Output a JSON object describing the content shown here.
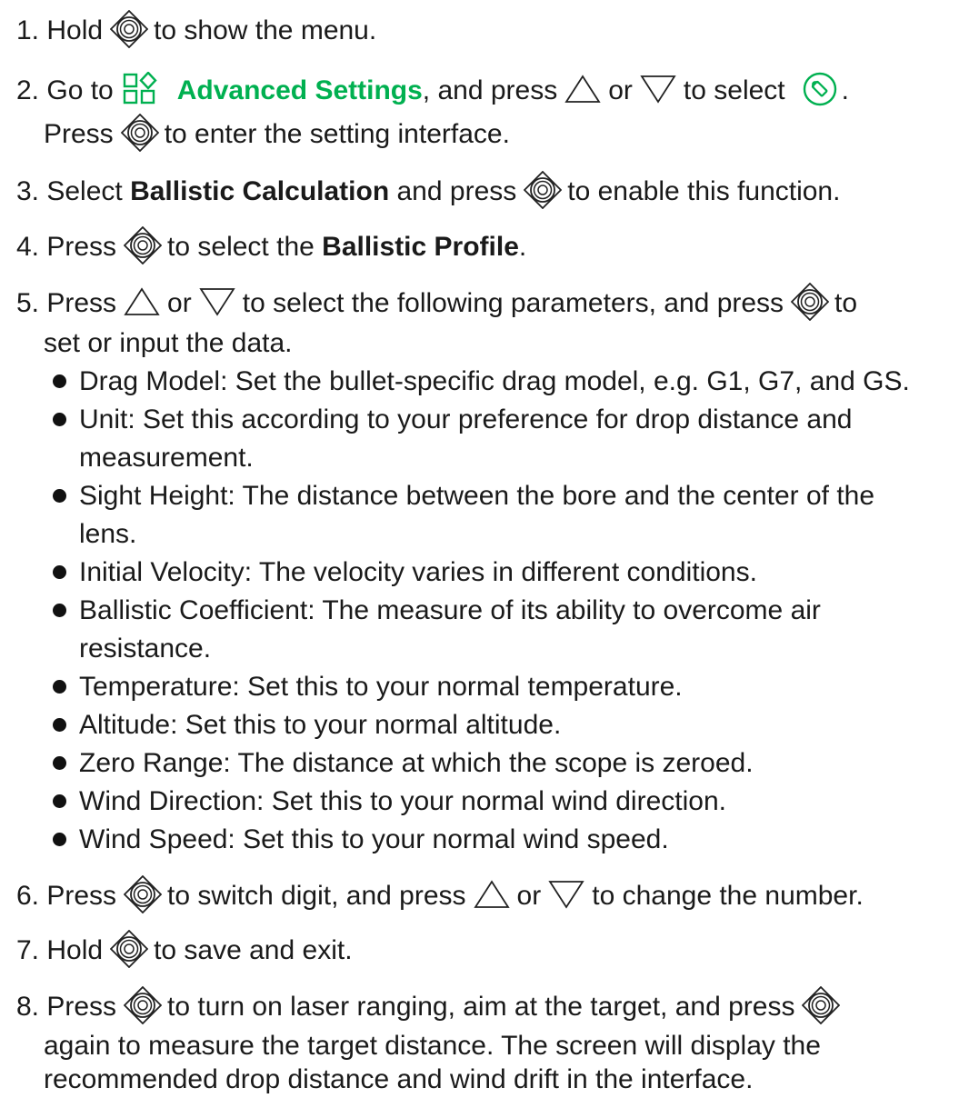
{
  "colors": {
    "text": "#1a1a1a",
    "accent": "#00b050"
  },
  "steps": {
    "s1": {
      "a": "1. Hold",
      "b": "to show the menu."
    },
    "s2": {
      "a": "2. Go to",
      "bold": "Advanced Settings",
      "b": ", and press",
      "c": "or",
      "d": "to select",
      "e": ".",
      "a2": "Press",
      "b2": "to enter the setting interface."
    },
    "s3": {
      "a": "3. Select",
      "bold": "Ballistic Calculation",
      "b": "and press",
      "c": "to enable this function."
    },
    "s4": {
      "a": "4. Press",
      "b": "to select the",
      "bold": "Ballistic Profile",
      "c": "."
    },
    "s5": {
      "a": "5. Press",
      "b": "or",
      "c": "to select the following parameters, and press",
      "d": "to",
      "e": "set or input the data."
    },
    "bullets": [
      "Drag Model: Set the bullet-specific drag model, e.g. G1, G7, and GS.",
      "Unit: Set this according to your preference for drop distance and",
      "measurement.",
      "Sight Height: The distance between the bore and the center of the",
      "lens.",
      "Initial Velocity: The velocity varies in different conditions.",
      "Ballistic Coefficient: The measure of its ability to overcome air",
      "resistance.",
      "Temperature: Set this to your normal temperature.",
      "Altitude: Set this to your normal altitude.",
      "Zero Range: The distance at which the scope is zeroed.",
      "Wind Direction: Set this to your normal wind direction.",
      "Wind Speed: Set this to your normal wind speed."
    ],
    "s6": {
      "a": "6. Press",
      "b": "to switch digit, and press",
      "c": "or",
      "d": "to change the number."
    },
    "s7": {
      "a": "7. Hold",
      "b": "to save and exit."
    },
    "s8": {
      "a": "8. Press",
      "b": "to turn on laser ranging, aim at the target, and press",
      "l2": "again to measure the target distance. The screen will display the",
      "l3": "recommended drop distance and wind drift in the interface."
    }
  },
  "icons": {
    "dial": "dial-button-icon",
    "up": "up-triangle-icon",
    "down": "down-triangle-icon",
    "grid": "advanced-settings-icon",
    "profile": "ballistic-profile-icon"
  }
}
